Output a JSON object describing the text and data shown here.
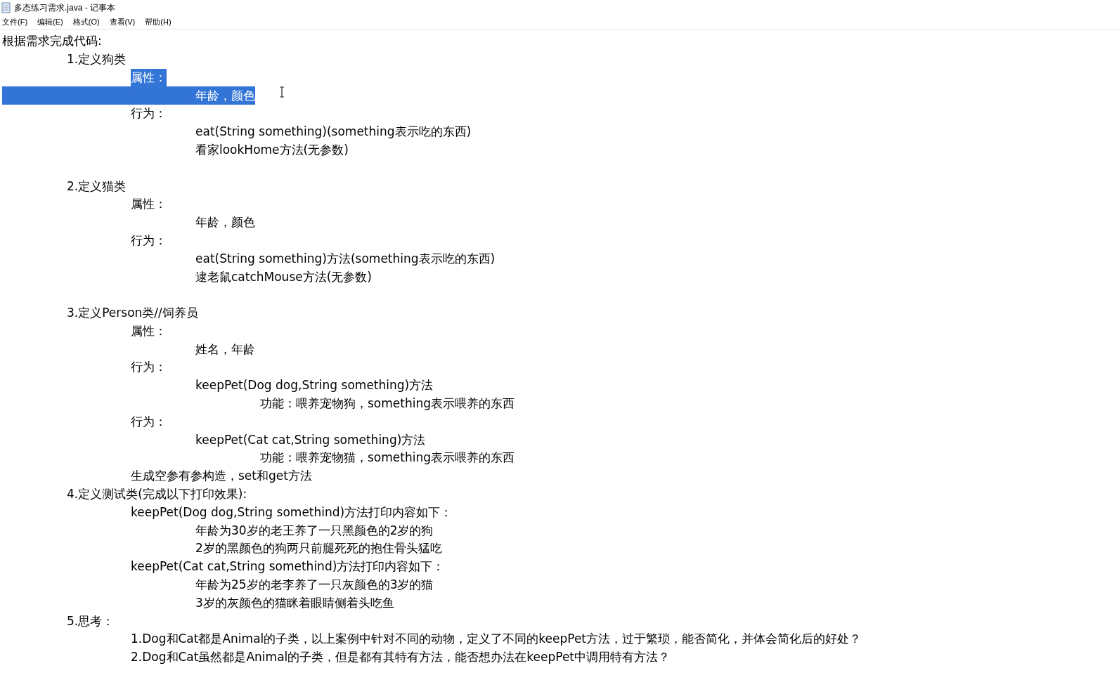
{
  "window": {
    "title": "多态练习需求.java - 记事本"
  },
  "menu": [
    {
      "label": "文件(F)"
    },
    {
      "label": "编辑(E)"
    },
    {
      "label": "格式(O)"
    },
    {
      "label": "查看(V)"
    },
    {
      "label": "帮助(H)"
    }
  ],
  "lines": [
    {
      "kind": "text",
      "text": "根据需求完成代码:",
      "selected": false,
      "children": [
        {
          "kind": "text",
          "text": "1.定义狗类",
          "selected": false,
          "children": [
            {
              "kind": "text",
              "text": "属性：",
              "selected": true,
              "children": [
                {
                  "kind": "text",
                  "text": "年龄，颜色",
                  "selected": true
                }
              ]
            },
            {
              "kind": "text",
              "text": "行为：",
              "selected": false,
              "children": [
                {
                  "kind": "text",
                  "text": "eat(String something)(something表示吃的东西)",
                  "selected": false
                },
                {
                  "kind": "text",
                  "text": "看家lookHome方法(无参数)",
                  "selected": false
                }
              ]
            }
          ]
        },
        {
          "kind": "blank"
        },
        {
          "kind": "text",
          "text": "2.定义猫类",
          "selected": false,
          "children": [
            {
              "kind": "text",
              "text": "属性：",
              "selected": false,
              "children": [
                {
                  "kind": "text",
                  "text": "年龄，颜色",
                  "selected": false
                }
              ]
            },
            {
              "kind": "text",
              "text": "行为：",
              "selected": false,
              "children": [
                {
                  "kind": "text",
                  "text": "eat(String something)方法(something表示吃的东西)",
                  "selected": false
                },
                {
                  "kind": "text",
                  "text": "逮老鼠catchMouse方法(无参数)",
                  "selected": false
                }
              ]
            }
          ]
        },
        {
          "kind": "blank"
        },
        {
          "kind": "text",
          "text": "3.定义Person类//饲养员",
          "selected": false,
          "children": [
            {
              "kind": "text",
              "text": "属性：",
              "selected": false,
              "children": [
                {
                  "kind": "text",
                  "text": "姓名，年龄",
                  "selected": false
                }
              ]
            },
            {
              "kind": "text",
              "text": "行为：",
              "selected": false,
              "children": [
                {
                  "kind": "text",
                  "text": "keepPet(Dog dog,String something)方法",
                  "selected": false,
                  "children": [
                    {
                      "kind": "text",
                      "text": "功能：喂养宠物狗，something表示喂养的东西",
                      "selected": false
                    }
                  ]
                }
              ]
            },
            {
              "kind": "text",
              "text": "行为：",
              "selected": false,
              "children": [
                {
                  "kind": "text",
                  "text": "keepPet(Cat cat,String something)方法",
                  "selected": false,
                  "children": [
                    {
                      "kind": "text",
                      "text": "功能：喂养宠物猫，something表示喂养的东西",
                      "selected": false
                    }
                  ]
                }
              ]
            },
            {
              "kind": "text",
              "text": "生成空参有参构造，set和get方法",
              "selected": false
            }
          ]
        },
        {
          "kind": "text",
          "text": "4.定义测试类(完成以下打印效果):",
          "selected": false,
          "children": [
            {
              "kind": "text",
              "text": "keepPet(Dog dog,String somethind)方法打印内容如下：",
              "selected": false,
              "children": [
                {
                  "kind": "text",
                  "text": "年龄为30岁的老王养了一只黑颜色的2岁的狗",
                  "selected": false
                },
                {
                  "kind": "text",
                  "text": "2岁的黑颜色的狗两只前腿死死的抱住骨头猛吃",
                  "selected": false
                }
              ]
            },
            {
              "kind": "text",
              "text": "keepPet(Cat cat,String somethind)方法打印内容如下：",
              "selected": false,
              "children": [
                {
                  "kind": "text",
                  "text": "年龄为25岁的老李养了一只灰颜色的3岁的猫",
                  "selected": false
                },
                {
                  "kind": "text",
                  "text": "3岁的灰颜色的猫眯着眼睛侧着头吃鱼",
                  "selected": false
                }
              ]
            }
          ]
        },
        {
          "kind": "text",
          "text": "5.思考：",
          "selected": false,
          "children": [
            {
              "kind": "text",
              "text": "1.Dog和Cat都是Animal的子类，以上案例中针对不同的动物，定义了不同的keepPet方法，过于繁琐，能否简化，并体会简化后的好处？",
              "selected": false
            },
            {
              "kind": "text",
              "text": "2.Dog和Cat虽然都是Animal的子类，但是都有其特有方法，能否想办法在keepPet中调用特有方法？",
              "selected": false
            }
          ]
        }
      ]
    }
  ]
}
